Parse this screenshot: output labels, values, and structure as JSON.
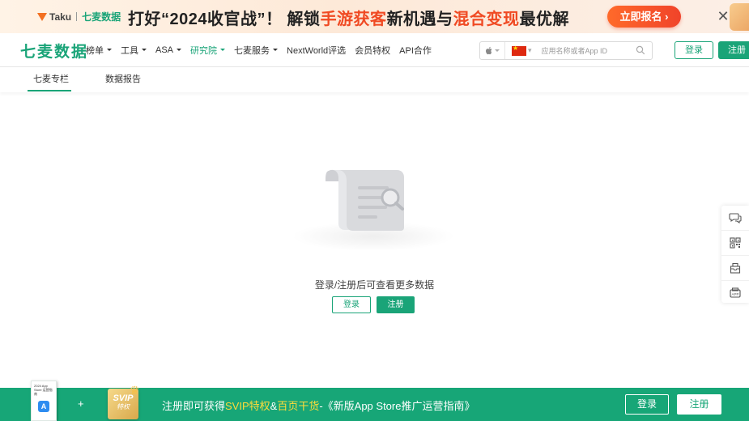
{
  "banner": {
    "logo_taku": "Taku",
    "logo_qimai": "七麦数据",
    "headline_1": "打好“2024收官战”！ 解锁",
    "headline_hl1": "手游获客",
    "headline_2": "新机遇与",
    "headline_hl2": "混合变现",
    "headline_3": "最优解",
    "cta_label": "立即报名",
    "cta_arrow": "›",
    "close_glyph": "✕"
  },
  "nav": {
    "brand": "七麦数据",
    "menu": [
      {
        "label": "榜单",
        "dropdown": true
      },
      {
        "label": "工具",
        "dropdown": true
      },
      {
        "label": "ASA",
        "dropdown": true
      },
      {
        "label": "研究院",
        "dropdown": true,
        "active": true
      },
      {
        "label": "七麦服务",
        "dropdown": true
      },
      {
        "label": "NextWorld评选",
        "dropdown": false
      },
      {
        "label": "会员特权",
        "dropdown": false
      },
      {
        "label": "API合作",
        "dropdown": false
      }
    ],
    "search": {
      "platform_icon": "apple-icon",
      "country_flag": "china-flag",
      "placeholder": "应用名称或者App ID"
    },
    "login_label": "登录",
    "register_label": "注册"
  },
  "subtabs": {
    "tabs": [
      {
        "label": "七麦专栏",
        "active": true
      },
      {
        "label": "数据报告",
        "active": false
      }
    ]
  },
  "empty_state": {
    "illustration": "document-search-illustration",
    "message": "登录/注册后可查看更多数据",
    "login_label": "登录",
    "register_label": "注册"
  },
  "side_toolbar": {
    "items": [
      "chat-icon",
      "qrcode-icon",
      "mail-icon",
      "app-icon"
    ]
  },
  "bottom_bar": {
    "book_title": "2024 App Store 运营指南",
    "book_icon": "A",
    "plus": "+",
    "svip_title": "SVIP",
    "svip_sub": "特权",
    "text_1": "注册即可获得",
    "text_hl1": "SVIP特权",
    "text_2": "&",
    "text_hl2": "百页干货",
    "text_3": "-《新版App Store推广运营指南》",
    "login_label": "登录",
    "register_label": "注册"
  },
  "colors": {
    "brand_green": "#1aa478",
    "banner_accent": "#f04a23",
    "bottom_bar": "#17a677",
    "bottom_highlight": "#ffdc3a"
  }
}
